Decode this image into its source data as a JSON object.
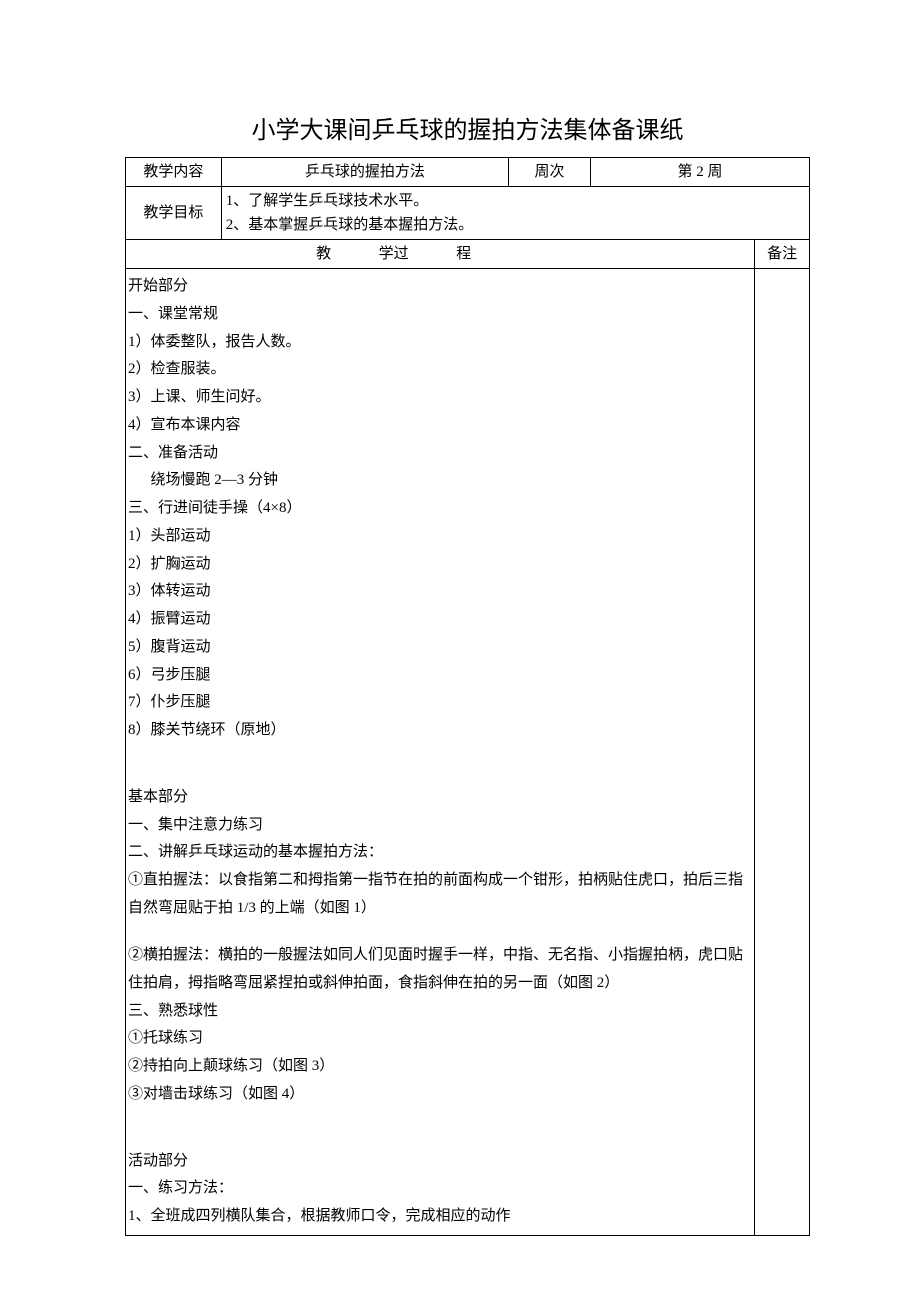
{
  "title": "小学大课间乒乓球的握拍方法集体备课纸",
  "row1": {
    "label_content": "教学内容",
    "content": "乒乓球的握拍方法",
    "label_week": "周次",
    "week": "第 2 周"
  },
  "row2": {
    "label_goal": "教学目标",
    "goal_1": "1、了解学生乒乓球技术水平。",
    "goal_2": "2、基本掌握乒乓球的基本握拍方法。"
  },
  "row3": {
    "process_hdr_a": "教",
    "process_hdr_b": "学过",
    "process_hdr_c": "程",
    "notes_hdr": "备注"
  },
  "process": {
    "p_start": "开始部分",
    "p_a": "一、课堂常规",
    "p_a1": "1）体委整队，报告人数。",
    "p_a2": "2）检查服装。",
    "p_a3": "3）上课、师生问好。",
    "p_a4": "4）宣布本课内容",
    "p_b": "二、准备活动",
    "p_b1": "绕场慢跑 2—3 分钟",
    "p_c": "三、行进间徒手操（4×8）",
    "p_c1": "1）头部运动",
    "p_c2": "2）扩胸运动",
    "p_c3": "3）体转运动",
    "p_c4": "4）振臂运动",
    "p_c5": "5）腹背运动",
    "p_c6": "6）弓步压腿",
    "p_c7": "7）仆步压腿",
    "p_c8": "8）膝关节绕环（原地）",
    "p_base": "基本部分",
    "p_d": "一、集中注意力练习",
    "p_e": "二、讲解乒乓球运动的基本握拍方法：",
    "p_e1": "①直拍握法：以食指第二和拇指第一指节在拍的前面构成一个钳形，拍柄贴住虎口，拍后三指自然弯屈贴于拍 1/3 的上端（如图 1）",
    "p_e2": "②横拍握法：横拍的一般握法如同人们见面时握手一样，中指、无名指、小指握拍柄，虎口贴住拍肩，拇指略弯屈紧捏拍或斜伸拍面，食指斜伸在拍的另一面（如图 2）",
    "p_f": "三、熟悉球性",
    "p_f1": "①托球练习",
    "p_f2": "②持拍向上颠球练习（如图 3）",
    "p_f3": "③对墙击球练习（如图 4）",
    "p_act": "活动部分",
    "p_g": "一、练习方法：",
    "p_g1": "1、全班成四列横队集合，根据教师口令，完成相应的动作"
  }
}
